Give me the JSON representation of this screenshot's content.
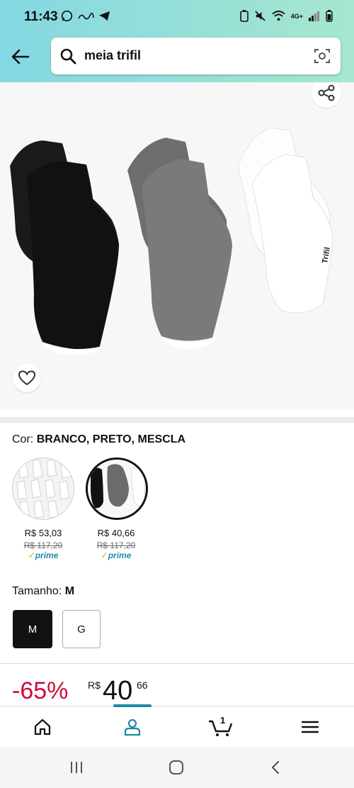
{
  "status": {
    "time": "11:43",
    "network": "4G+"
  },
  "search": {
    "query": "meia trifil"
  },
  "product": {
    "color_label": "Cor:",
    "color_value": "BRANCO, PRETO, MESCLA",
    "swatches": [
      {
        "price": "R$ 53,03",
        "old_price": "R$ 117,20",
        "prime": "prime"
      },
      {
        "price": "R$ 40,66",
        "old_price": "R$ 117,20",
        "prime": "prime"
      }
    ],
    "size_label": "Tamanho:",
    "size_value": "M",
    "sizes": [
      "M",
      "G"
    ],
    "discount": "-65%",
    "currency": "R$",
    "price_int": "40",
    "price_cents": "66",
    "brand_mark": "Trifil"
  },
  "cart": {
    "count": "1"
  },
  "colors": {
    "accent": "#1b8aa6",
    "discount": "#cc0c39",
    "prime": "#1e8bb0"
  }
}
